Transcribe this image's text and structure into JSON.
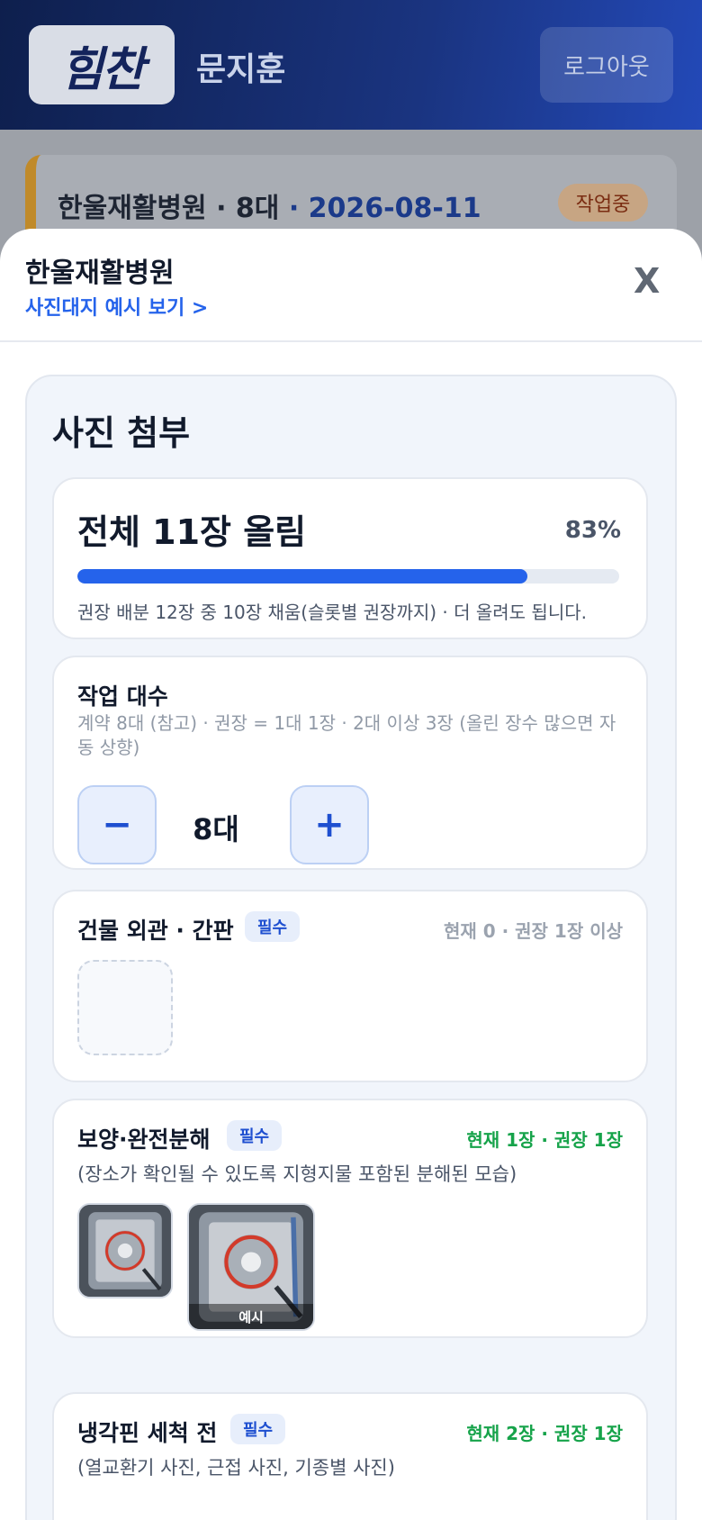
{
  "header": {
    "logo_text": "힘찬",
    "user_name": "문지훈",
    "logout_label": "로그아웃"
  },
  "background_job": {
    "hospital": "한울재활병원",
    "units": "· 8대",
    "date": "· 2026-08-11",
    "status": "작업중"
  },
  "sheet": {
    "title": "한울재활병원",
    "example_link": "사진대지 예시 보기 >",
    "close_label": "X"
  },
  "photo_panel": {
    "title": "사진 첨부",
    "progress": {
      "title": "전체 11장 올림",
      "percent_label": "83%",
      "fill_fraction": 0.83,
      "note": "권장 배분 12장 중 10장 채움(슬롯별 권장까지) · 더 올려도 됩니다."
    },
    "units": {
      "title": "작업 대수",
      "description": "계약 8대 (참고) · 권장 = 1대 1장 · 2대 이상 3장 (올린 장수 많으면 자동 상향)",
      "minus_label": "−",
      "value": "8대",
      "plus_label": "+"
    },
    "slots": [
      {
        "title": "건물 외관 · 간판",
        "badge": "필수",
        "count": "현재 0 · 권장 1장 이상",
        "count_color": "#9ba3af"
      },
      {
        "title": "보양·완전분해",
        "badge": "필수",
        "count": "현재 1장 · 권장 1장",
        "count_color": "#16a34a",
        "description": "(장소가 확인될 수 있도록 지형지물 포함된 분해된 모습)",
        "example_label": "예시"
      },
      {
        "title": "냉각핀 세척 전",
        "badge": "필수",
        "count": "현재 2장 · 권장 1장",
        "count_color": "#16a34a",
        "description": "(열교환기 사진, 근접 사진, 기종별 사진)"
      }
    ]
  },
  "colors": {
    "accent": "#2563eb",
    "header_dark": "#0e1f4d",
    "ok_green": "#16a34a",
    "status_orange": "#c08a2a"
  }
}
